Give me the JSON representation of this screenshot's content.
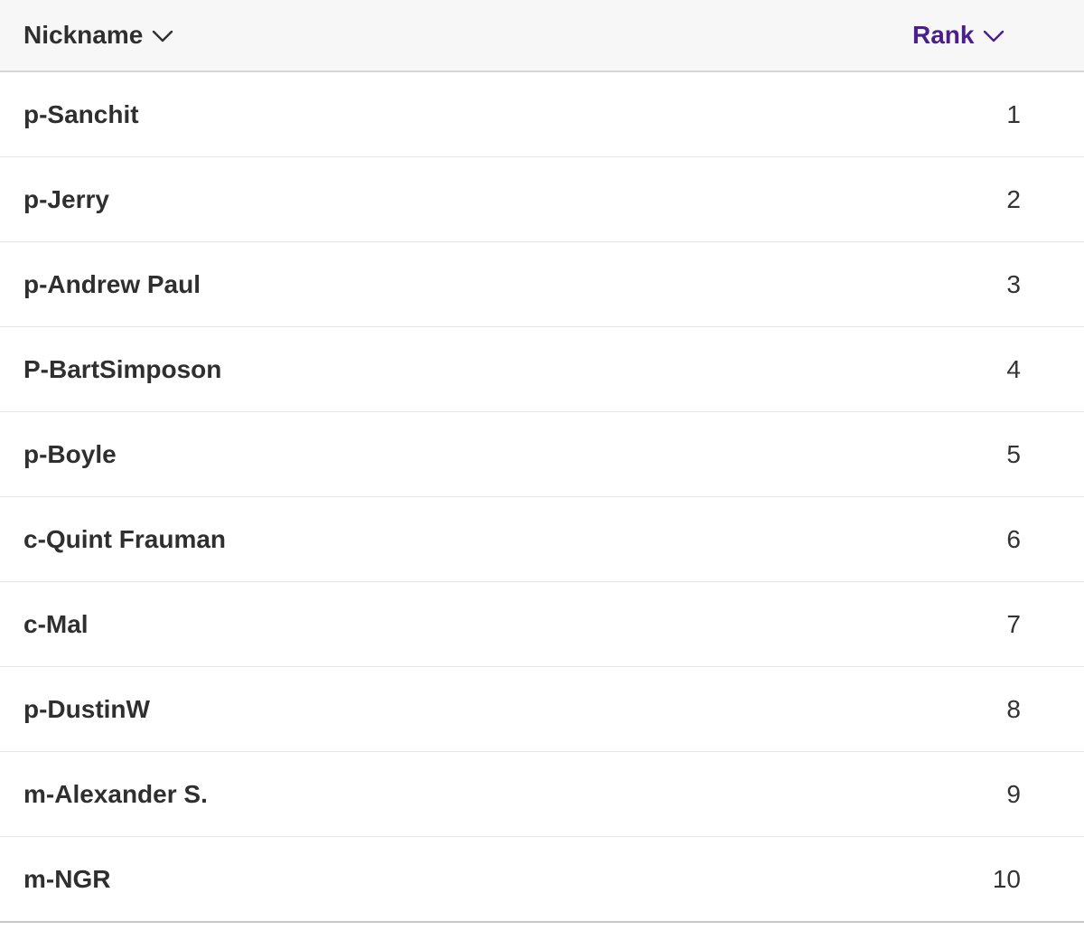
{
  "table": {
    "columns": {
      "nickname": {
        "label": "Nickname",
        "icon": "chevron-down-icon"
      },
      "rank": {
        "label": "Rank",
        "icon": "chevron-down-icon",
        "active_color": "#4a1e8c"
      }
    },
    "rows": [
      {
        "nickname": "p-Sanchit",
        "rank": "1"
      },
      {
        "nickname": "p-Jerry",
        "rank": "2"
      },
      {
        "nickname": "p-Andrew Paul",
        "rank": "3"
      },
      {
        "nickname": "P-BartSimposon",
        "rank": "4"
      },
      {
        "nickname": "p-Boyle",
        "rank": "5"
      },
      {
        "nickname": "c-Quint Frauman",
        "rank": "6"
      },
      {
        "nickname": "c-Mal",
        "rank": "7"
      },
      {
        "nickname": "p-DustinW",
        "rank": "8"
      },
      {
        "nickname": "m-Alexander S.",
        "rank": "9"
      },
      {
        "nickname": "m-NGR",
        "rank": "10"
      }
    ]
  }
}
